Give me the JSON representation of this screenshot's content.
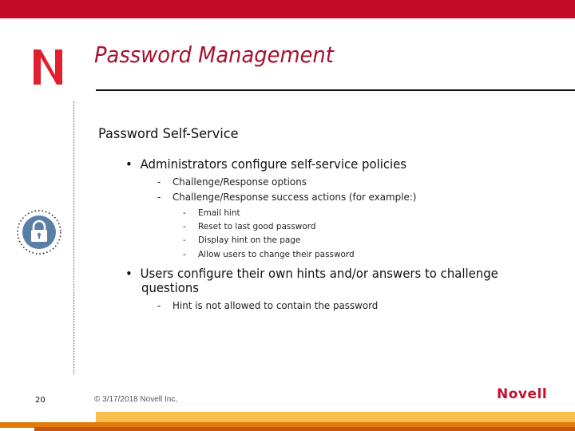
{
  "slide": {
    "title": "Password Management",
    "subtitle": "Password Self-Service",
    "bullets": [
      {
        "text": "Administrators configure self-service policies",
        "items": [
          {
            "text": "Challenge/Response options"
          },
          {
            "text": "Challenge/Response success actions (for example:)",
            "items": [
              "Email hint",
              "Reset to last good password",
              "Display hint on the page",
              "Allow users to change their password"
            ]
          }
        ]
      },
      {
        "text_line1": "Users configure their own hints and/or answers to challenge",
        "text_line2": "questions",
        "items": [
          {
            "text": "Hint is not allowed to contain the password"
          }
        ]
      }
    ],
    "bullet_glyph": "•",
    "dash_glyph": "-"
  },
  "footer": {
    "page_number": "20",
    "copyright": "© 3/17/2018 Novell Inc,",
    "brand": "Novell",
    "brand_mark": "."
  },
  "icons": {
    "logo": "novell-n-logo",
    "side": "padlock-icon"
  },
  "colors": {
    "brand_red": "#c30a26",
    "title_red": "#a8112e",
    "band_yellow": "#f9c04d",
    "band_orange": "#e07a0b",
    "band_dark": "#c9550b",
    "lock_blue": "#5a7fa6"
  }
}
